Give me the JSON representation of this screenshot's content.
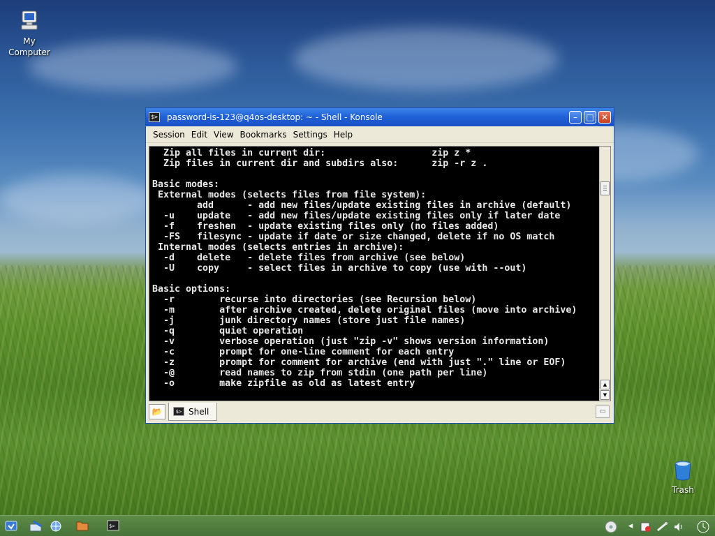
{
  "desktop": {
    "icons": [
      {
        "label": "My\nComputer",
        "icon": "computer-icon"
      },
      {
        "label": "Trash",
        "icon": "trash-icon"
      }
    ]
  },
  "window": {
    "title": "password-is-123@q4os-desktop: ~ - Shell - Konsole",
    "buttons": {
      "minimize": "–",
      "maximize": "□",
      "close": "✕"
    },
    "menu": [
      "Session",
      "Edit",
      "View",
      "Bookmarks",
      "Settings",
      "Help"
    ],
    "terminal_lines": [
      "  Zip all files in current dir:                   zip z *",
      "  Zip files in current dir and subdirs also:      zip -r z .",
      "",
      "Basic modes:",
      " External modes (selects files from file system):",
      "        add      - add new files/update existing files in archive (default)",
      "  -u    update   - add new files/update existing files only if later date",
      "  -f    freshen  - update existing files only (no files added)",
      "  -FS   filesync - update if date or size changed, delete if no OS match",
      " Internal modes (selects entries in archive):",
      "  -d    delete   - delete files from archive (see below)",
      "  -U    copy     - select files in archive to copy (use with --out)",
      "",
      "Basic options:",
      "  -r        recurse into directories (see Recursion below)",
      "  -m        after archive created, delete original files (move into archive)",
      "  -j        junk directory names (store just file names)",
      "  -q        quiet operation",
      "  -v        verbose operation (just \"zip -v\" shows version information)",
      "  -c        prompt for one-line comment for each entry",
      "  -z        prompt for comment for archive (end with just \".\" line or EOF)",
      "  -@        read names to zip from stdin (one path per line)",
      "  -o        make zipfile as old as latest entry"
    ],
    "tab_label": "Shell"
  },
  "taskbar": {
    "items": [
      "start-icon",
      "applications-icon",
      "network-icon",
      "file-manager-icon",
      "konsole-icon"
    ],
    "tray": [
      "cd-icon",
      "arrow-left-icon",
      "update-icon",
      "network-tray-icon",
      "volume-icon",
      "clock-icon"
    ]
  }
}
